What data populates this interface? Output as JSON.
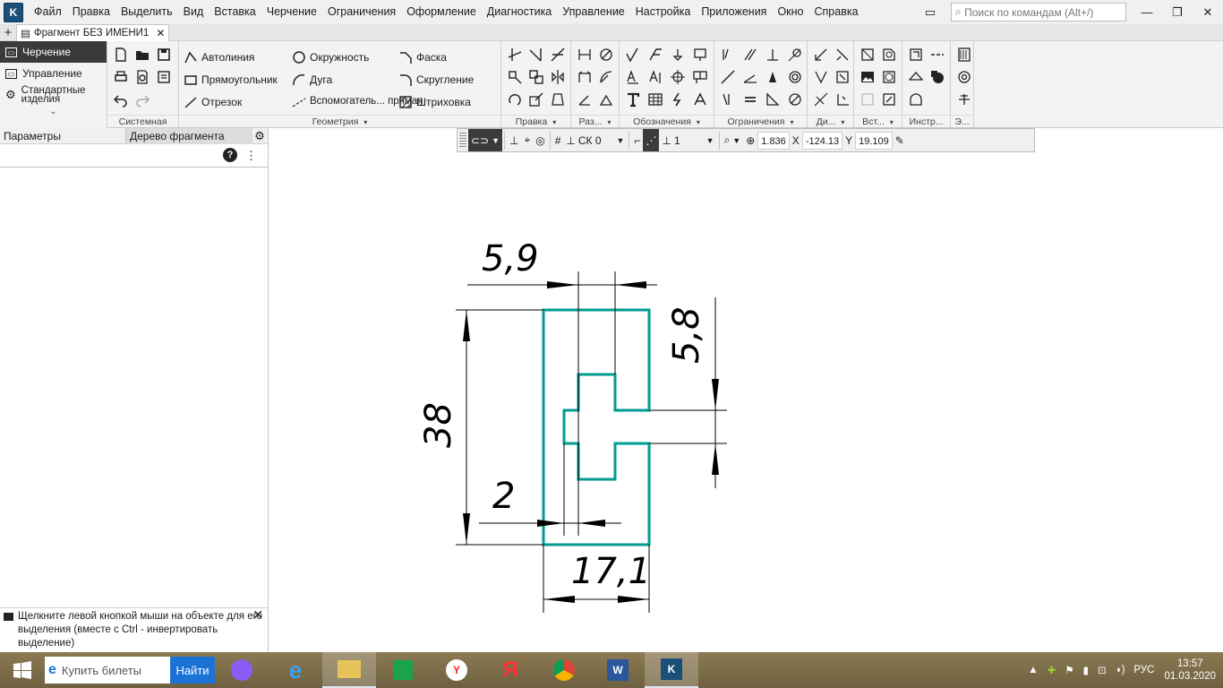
{
  "menubar": {
    "items": [
      "Файл",
      "Правка",
      "Выделить",
      "Вид",
      "Вставка",
      "Черчение",
      "Ограничения",
      "Оформление",
      "Диагностика",
      "Управление",
      "Настройка",
      "Приложения",
      "Окно",
      "Справка"
    ],
    "search_placeholder": "Поиск по командам (Alt+/)"
  },
  "tabstrip": {
    "doc_tab": "Фрагмент БЕЗ ИМЕНИ1"
  },
  "leftnav": {
    "items": [
      "Черчение",
      "Управление",
      "Стандартные изделия"
    ]
  },
  "ribbon": {
    "groups": [
      "Системная",
      "Геометрия",
      "Правка",
      "Раз...",
      "Обозначения",
      "Ограничения",
      "Ди...",
      "Вст...",
      "Инстр...",
      "Э..."
    ],
    "geometry": {
      "col1": [
        "Автолиния",
        "Прямоугольник",
        "Отрезок"
      ],
      "col2": [
        "Окружность",
        "Дуга",
        "Вспомогатель... прямая"
      ],
      "col3": [
        "Фаска",
        "Скругление",
        "Штриховка"
      ]
    }
  },
  "leftpanel": {
    "tab_params": "Параметры",
    "tab_tree": "Дерево фрагмента",
    "hint": "Щелкните левой кнопкой мыши на объекте для его выделения (вместе с Ctrl - инвертировать выделение)"
  },
  "drawbar": {
    "cs": "СК 0",
    "layer": "1",
    "zoom": "1.836",
    "x_label": "X",
    "x_value": "-124.13",
    "y_label": "Y",
    "y_value": "19.109"
  },
  "drawing": {
    "dims": {
      "top_width": "5,9",
      "right_height": "5,8",
      "left_height": "38",
      "slot_width": "2",
      "bottom_width": "17,1"
    },
    "profile_color": "#009b91"
  },
  "taskbar": {
    "search_placeholder": "Купить билеты",
    "search_button": "Найти",
    "lang": "РУС",
    "time": "13:57",
    "date": "01.03.2020"
  }
}
